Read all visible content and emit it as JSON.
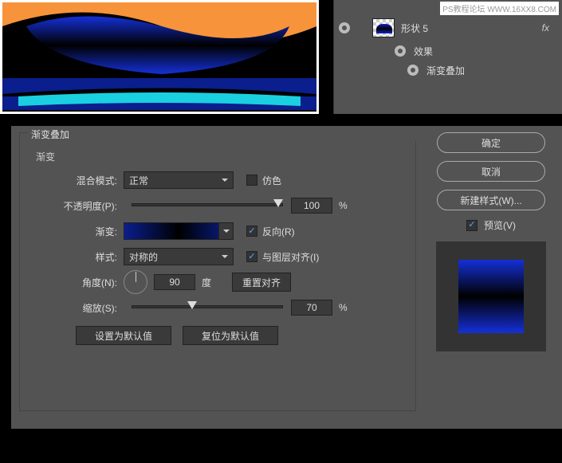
{
  "watermark": "PS教程论坛 WWW.16XX8.COM",
  "layers": {
    "name": "形状 5",
    "fx": "fx",
    "effects_label": "效果",
    "gradient_overlay_label": "渐变叠加"
  },
  "dialog": {
    "title": "渐变叠加",
    "section": "渐变",
    "blend_mode_label": "混合模式:",
    "blend_mode_value": "正常",
    "dither_label": "仿色",
    "opacity_label": "不透明度(P):",
    "opacity_value": "100",
    "percent": "%",
    "gradient_label": "渐变:",
    "reverse_label": "反向(R)",
    "style_label": "样式:",
    "style_value": "对称的",
    "align_label": "与图层对齐(I)",
    "angle_label": "角度(N):",
    "angle_value": "90",
    "degree": "度",
    "reset_align": "重置对齐",
    "scale_label": "缩放(S):",
    "scale_value": "70",
    "set_default": "设置为默认值",
    "reset_default": "复位为默认值"
  },
  "buttons": {
    "ok": "确定",
    "cancel": "取消",
    "new_style": "新建样式(W)...",
    "preview": "预览(V)"
  }
}
